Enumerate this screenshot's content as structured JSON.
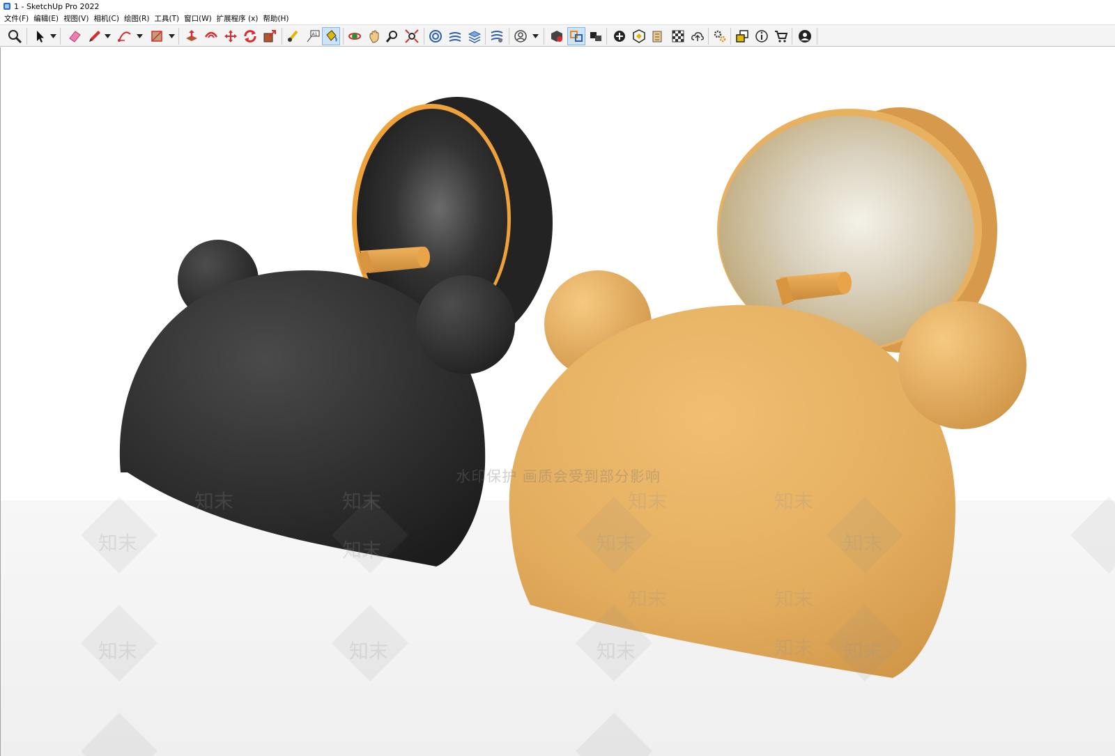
{
  "window": {
    "title": "1 - SketchUp Pro 2022"
  },
  "menu": [
    "文件(F)",
    "编辑(E)",
    "视图(V)",
    "相机(C)",
    "绘图(R)",
    "工具(T)",
    "窗口(W)",
    "扩展程序 (x)",
    "帮助(H)"
  ],
  "toolbar": {
    "tools": [
      "zoom-icon",
      "select-icon",
      "eraser-icon",
      "pencil-icon",
      "arc-icon",
      "rectangle-icon",
      "push-pull-icon",
      "offset-icon",
      "move-icon",
      "rotate-icon",
      "scale-icon",
      "tape-measure-icon",
      "text-icon",
      "paint-bucket-icon",
      "orbit-icon",
      "pan-icon",
      "zoom-window-icon",
      "zoom-extents-icon",
      "warehouse-icon",
      "sandbox-icon",
      "layers-icon",
      "section-icon",
      "user-icon",
      "model-info-icon",
      "component-icon",
      "scenes-icon",
      "add-location-icon",
      "shadows-icon",
      "styles-icon",
      "materials-icon",
      "upload-icon",
      "extension-icon",
      "outliner-icon",
      "info-icon",
      "cart-icon",
      "account-icon"
    ],
    "active_tool": "paint-bucket-icon"
  },
  "colors": {
    "black_body": "#2e2e2e",
    "gold_body": "#e3ad5e",
    "gold_trim": "#f0a23a",
    "disk_silver": "#d9d2c0",
    "toolbar_bg": "#f4f4f4",
    "active_bg": "#cfe3f7"
  },
  "watermark": {
    "text": "水印保护   画质会受到部分影响",
    "brand": "知末"
  }
}
